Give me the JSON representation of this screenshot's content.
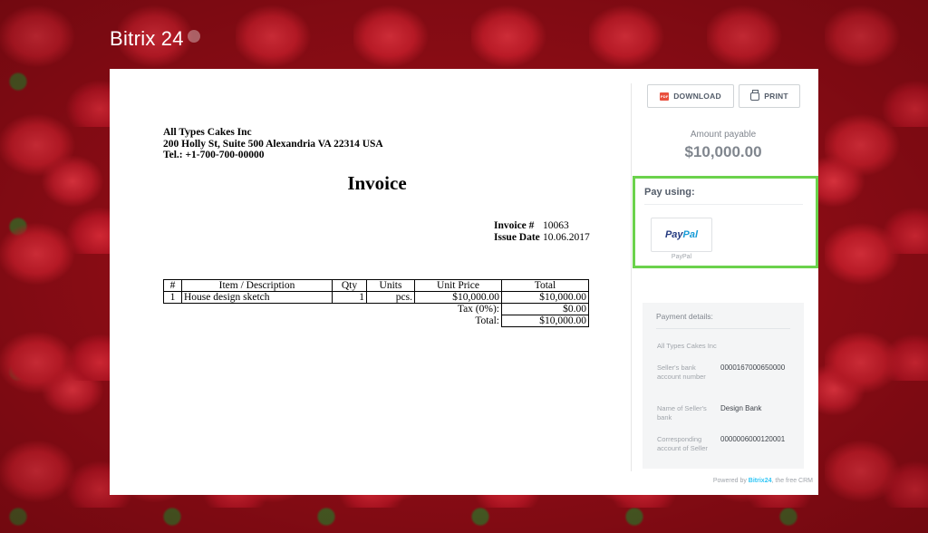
{
  "brand": {
    "name": "Bitrix",
    "num": "24"
  },
  "toolbar": {
    "download_label": "DOWNLOAD",
    "print_label": "PRINT",
    "pdf_icon_text": "PDF"
  },
  "amount": {
    "label": "Amount payable",
    "value": "$10,000.00"
  },
  "pay": {
    "title": "Pay using:",
    "paypal_part1": "Pay",
    "paypal_part2": "Pal",
    "paypal_caption": "PayPal"
  },
  "seller": {
    "name": "All Types Cakes Inc",
    "address": "200 Holly St, Suite 500 Alexandria VA 22314 USA",
    "phone": "Tel.: +1-700-700-00000"
  },
  "invoice": {
    "title": "Invoice",
    "number_label": "Invoice #",
    "number": "10063",
    "date_label": "Issue Date",
    "date": "10.06.2017"
  },
  "table": {
    "headers": [
      "#",
      "Item / Description",
      "Qty",
      "Units",
      "Unit Price",
      "Total"
    ],
    "rows": [
      {
        "num": "1",
        "desc": "House design sketch",
        "qty": "1",
        "units": "pcs.",
        "price": "$10,000.00",
        "total": "$10,000.00"
      }
    ],
    "tax_label": "Tax (0%):",
    "tax_value": "$0.00",
    "total_label": "Total:",
    "total_value": "$10,000.00"
  },
  "details": {
    "title": "Payment details:",
    "seller_name": "All Types Cakes Inc",
    "rows": [
      {
        "key": "Seller's bank account number",
        "value": "0000167000650000"
      },
      {
        "key": "Name of Seller's bank",
        "value": "Design Bank"
      },
      {
        "key": "Corresponding account of Seller",
        "value": "0000006000120001"
      }
    ]
  },
  "footer": {
    "powered_by": "Powered by",
    "brand": "Bitrix24",
    "suffix": ", the free CRM"
  },
  "colors": {
    "accent_green": "#6bd24c",
    "bitrix_blue": "#2fc6f6",
    "paypal_dark": "#253b80",
    "paypal_light": "#179bd7"
  }
}
